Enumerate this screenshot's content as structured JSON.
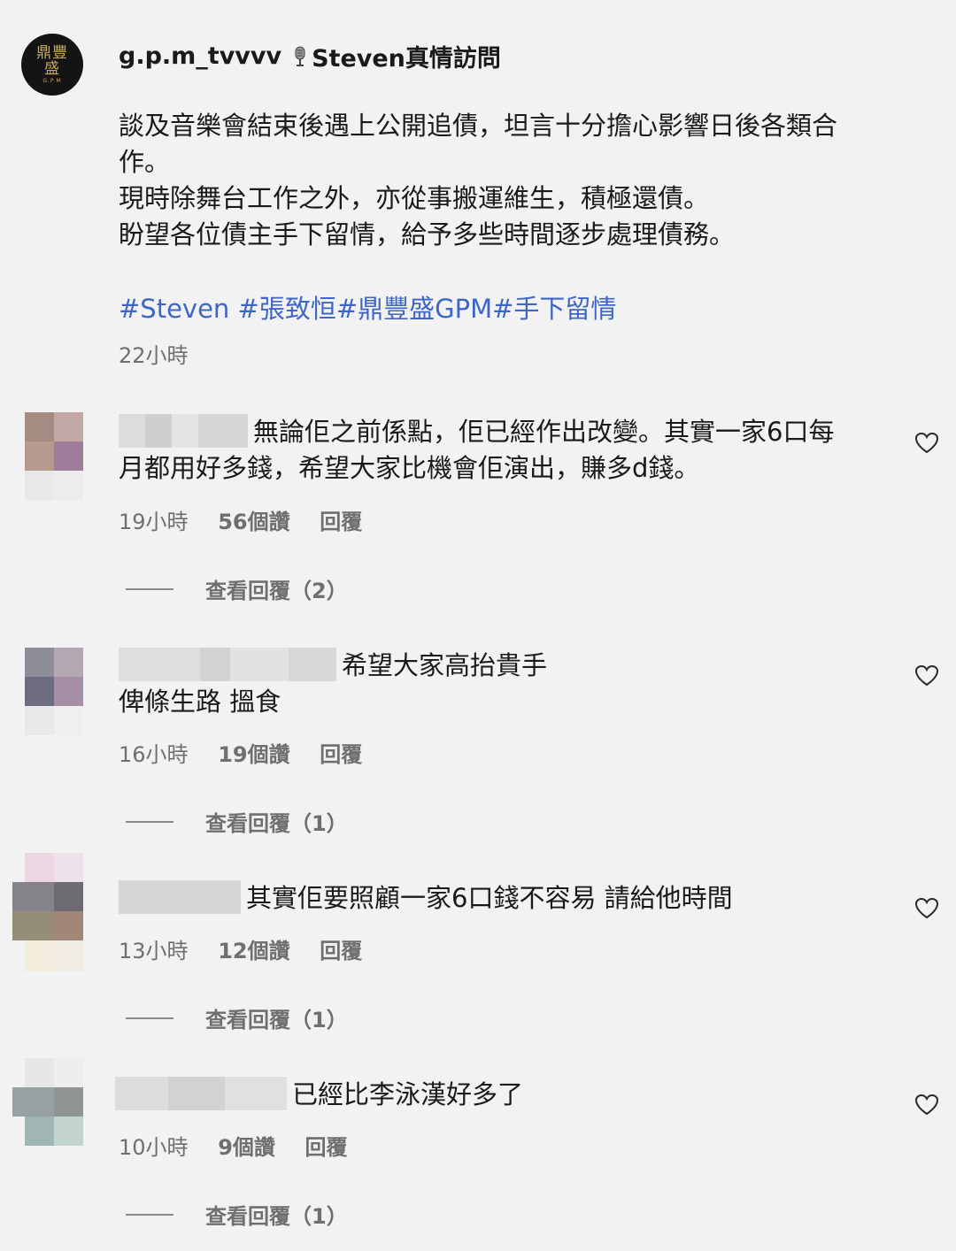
{
  "post": {
    "username": "g.p.m_tvvvv",
    "title": "Steven真情訪問",
    "avatar_text_top": "鼎豐",
    "avatar_text_bottom": "盛",
    "avatar_sub": "G.P.M",
    "caption_lines": [
      "談及音樂會結束後遇上公開追債，坦言十分擔心影響日後各類合",
      "作。",
      "現時除舞台工作之外，亦從事搬運維生，積極還債。",
      "盼望各位債主手下留情，給予多些時間逐步處理債務。"
    ],
    "hashtags": "#Steven #張致恒#鼎豐盛GPM#手下留情",
    "time": "22小時"
  },
  "comments": [
    {
      "text_line1": "無論佢之前係點，佢已經作出改變。其實一家6口每",
      "text_line2": "月都用好多錢，希望大家比機會佢演出，賺多d錢。",
      "time": "19小時",
      "likes": "56個讚",
      "reply": "回覆",
      "view_replies": "查看回覆（2）"
    },
    {
      "text_line1": "希望大家高抬貴手",
      "text_line2": "俾條生路 搵食",
      "time": "16小時",
      "likes": "19個讚",
      "reply": "回覆",
      "view_replies": "查看回覆（1）"
    },
    {
      "text_line1": "其實佢要照顧一家6口錢不容易 請給他時間",
      "time": "13小時",
      "likes": "12個讚",
      "reply": "回覆",
      "view_replies": "查看回覆（1）"
    },
    {
      "text_line1": "已經比李泳漢好多了",
      "time": "10小時",
      "likes": "9個讚",
      "reply": "回覆",
      "view_replies": "查看回覆（1）"
    }
  ],
  "icons": {
    "like": "heart-outline-icon",
    "microphone": "microphone-icon"
  },
  "colors": {
    "hashtag": "#3f66c5",
    "meta": "#6f6f6f",
    "background": "#f2f2f2"
  }
}
